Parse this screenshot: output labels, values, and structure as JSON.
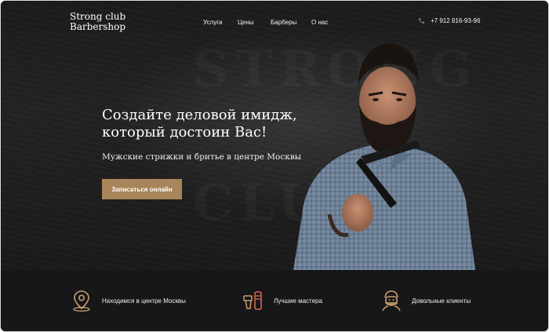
{
  "brand": {
    "line1": "Strong club",
    "line2": "Barbershop"
  },
  "nav": {
    "items": [
      "Услуги",
      "Цены",
      "Барберы",
      "О нас"
    ]
  },
  "phone": {
    "icon": "phone-icon",
    "number": "+7 912 816-93-96"
  },
  "hero": {
    "headline_line1": "Создайте деловой имидж,",
    "headline_line2": "который достоин Вас!",
    "subline": "Мужские стрижки и бритье в центре Москвы",
    "cta_label": "Записаться онлайн",
    "watermark_1": "STRONG",
    "watermark_2": "CLUB"
  },
  "features": [
    {
      "icon": "location-pin-icon",
      "label": "Находимся в центре Москвы"
    },
    {
      "icon": "barber-tools-icon",
      "label": "Лучшие мастера"
    },
    {
      "icon": "bearded-man-icon",
      "label": "Довольные клиенты"
    }
  ],
  "colors": {
    "accent": "#a8855a",
    "hero_bg": "#1f1f1f",
    "features_bg": "#17171a",
    "text": "#ffffff"
  }
}
